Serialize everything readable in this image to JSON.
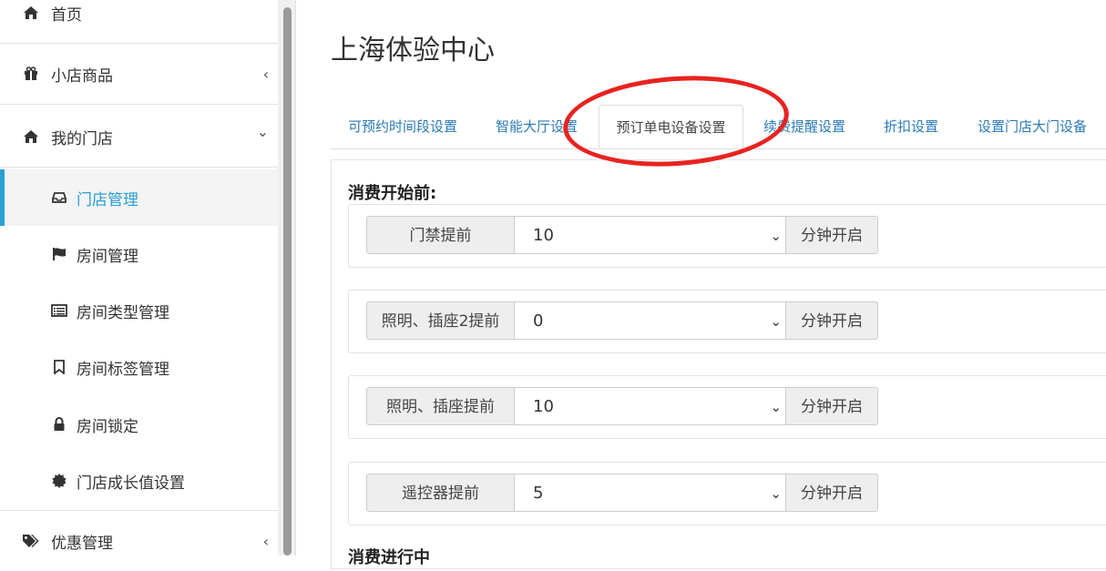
{
  "sidebar": {
    "home": {
      "label": "首页",
      "icon": "home-icon"
    },
    "shop_goods": {
      "label": "小店商品",
      "icon": "gift-icon",
      "chevron": "‹"
    },
    "my_store": {
      "label": "我的门店",
      "icon": "home-icon",
      "chevron": "⌄"
    },
    "sub_items": [
      {
        "label": "门店管理",
        "icon": "inbox-icon",
        "active": true
      },
      {
        "label": "房间管理",
        "icon": "flag-icon"
      },
      {
        "label": "房间类型管理",
        "icon": "list-icon"
      },
      {
        "label": "房间标签管理",
        "icon": "bookmark-icon"
      },
      {
        "label": "房间锁定",
        "icon": "lock-icon"
      },
      {
        "label": "门店成长值设置",
        "icon": "badge-icon"
      }
    ],
    "promo": {
      "label": "优惠管理",
      "icon": "tags-icon",
      "chevron": "‹"
    }
  },
  "main": {
    "title": "上海体验中心",
    "tabs": [
      {
        "label": "可预约时间段设置"
      },
      {
        "label": "智能大厅设置"
      },
      {
        "label": "预订单电设备设置",
        "active": true
      },
      {
        "label": "续费提醒设置"
      },
      {
        "label": "折扣设置"
      },
      {
        "label": "设置门店大门设备"
      }
    ],
    "section_title": "消费开始前:",
    "section_title2": "消费进行中",
    "rows": [
      {
        "label": "门禁提前",
        "value": "10",
        "suffix": "分钟开启"
      },
      {
        "label": "照明、插座2提前",
        "value": "0",
        "suffix": "分钟开启"
      },
      {
        "label": "照明、插座提前",
        "value": "10",
        "suffix": "分钟开启"
      },
      {
        "label": "遥控器提前",
        "value": "5",
        "suffix": "分钟开启"
      }
    ]
  },
  "colors": {
    "accent": "#2a9fd6",
    "link": "#2a7ab5",
    "annotation": "#e8231f"
  }
}
